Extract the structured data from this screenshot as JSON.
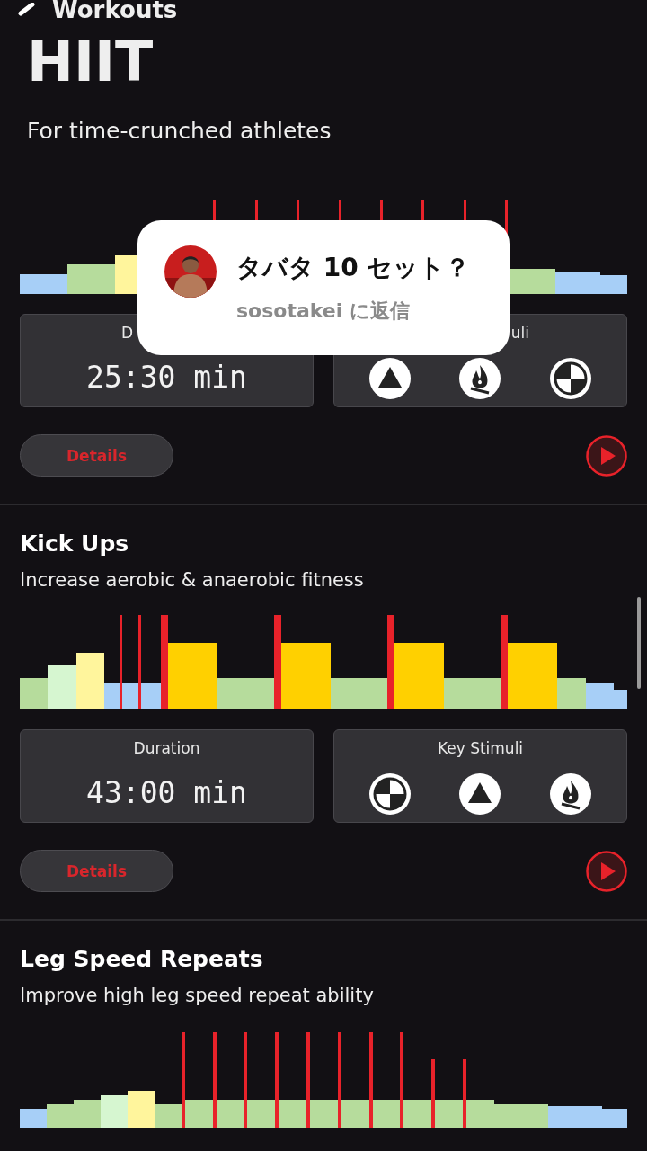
{
  "nav": {
    "back_label": "Workouts"
  },
  "header": {
    "title": "HIIT",
    "subtitle": "For time-crunched athletes"
  },
  "workouts": [
    {
      "duration_label": "D",
      "duration": "25:30 min",
      "stimuli_label": "uli",
      "stimuli": [
        {
          "kind": "triangle"
        },
        {
          "kind": "flame"
        },
        {
          "kind": "quadrant"
        }
      ],
      "details_label": "Details"
    },
    {
      "title": "Kick Ups",
      "subtitle": "Increase aerobic & anaerobic fitness",
      "duration_label": "Duration",
      "duration": "43:00 min",
      "stimuli_label": "Key Stimuli",
      "stimuli": [
        {
          "kind": "quadrant"
        },
        {
          "kind": "triangle"
        },
        {
          "kind": "flame"
        }
      ],
      "details_label": "Details"
    },
    {
      "title": "Leg Speed Repeats",
      "subtitle": "Improve high leg speed repeat ability"
    }
  ],
  "reply_popup": {
    "message": "タバタ 10 セット？",
    "reply_to": "sosotakei に返信"
  }
}
